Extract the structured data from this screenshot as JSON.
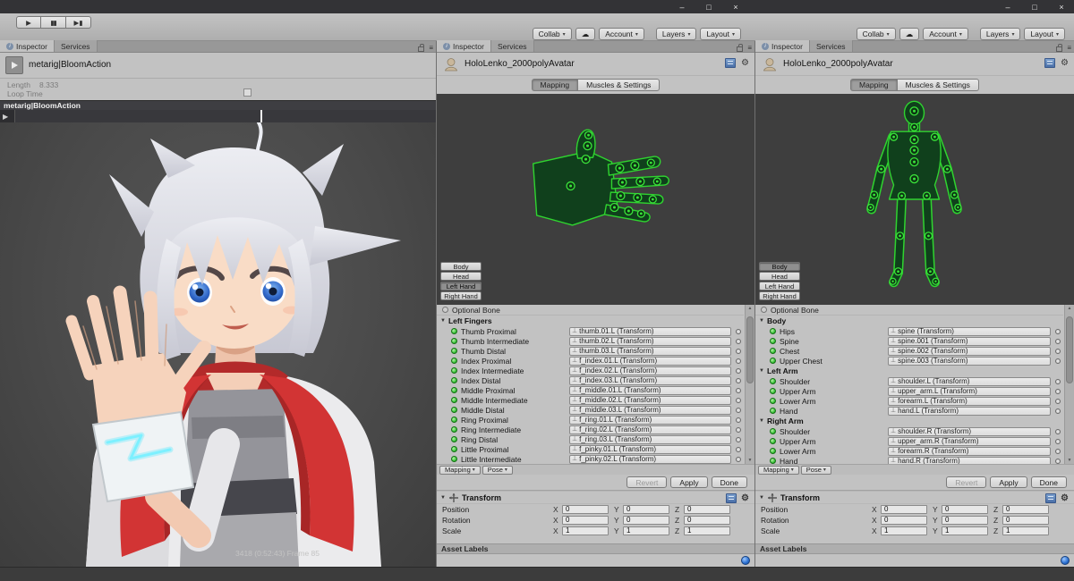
{
  "titlebar": {
    "minimize": "–",
    "restore": "□",
    "close": "×"
  },
  "icons": {
    "play": "▶",
    "pause": "▮▮",
    "step": "▶▮",
    "cloud": "☁",
    "dropdown": "▾",
    "menu": "≡",
    "info": "i",
    "transform_glyph": "⊥",
    "foldout": "▼",
    "gear": "⚙",
    "scroll_up": "▲",
    "scroll_down": "▼"
  },
  "toolbar": {
    "collab_label": "Collab",
    "account_label": "Account",
    "layers_label": "Layers",
    "layout_label": "Layout"
  },
  "tabs": {
    "inspector": "Inspector",
    "services": "Services"
  },
  "left_panel": {
    "clip_name": "metarig|BloomAction",
    "length_label": "Length",
    "length_value": "8.333",
    "loop_time_label": "Loop Time",
    "preview_title": "metarig|BloomAction",
    "frame_info": "3418 (0:52:43)  Frame 85"
  },
  "avatar": {
    "asset_name": "HoloLenko_2000polyAvatar",
    "mapping_tab": "Mapping",
    "muscles_tab": "Muscles & Settings",
    "view_buttons": [
      "Body",
      "Head",
      "Left Hand",
      "Right Hand"
    ],
    "optional_bone": "Optional Bone",
    "mapping_menu": "Mapping",
    "pose_menu": "Pose",
    "revert": "Revert",
    "apply": "Apply",
    "done": "Done",
    "transform_title": "Transform",
    "axis_labels": {
      "x": "X",
      "y": "Y",
      "z": "Z"
    },
    "transform_rows": [
      {
        "label": "Position",
        "x": "0",
        "y": "0",
        "z": "0"
      },
      {
        "label": "Rotation",
        "x": "0",
        "y": "0",
        "z": "0"
      },
      {
        "label": "Scale",
        "x": "1",
        "y": "1",
        "z": "1"
      }
    ],
    "asset_labels_title": "Asset Labels"
  },
  "hand_inspector": {
    "selected_view": "Left Hand",
    "groups": [
      {
        "name": "Left Fingers",
        "bones": [
          {
            "label": "Thumb Proximal",
            "target": "thumb.01.L (Transform)"
          },
          {
            "label": "Thumb Intermediate",
            "target": "thumb.02.L (Transform)"
          },
          {
            "label": "Thumb Distal",
            "target": "thumb.03.L (Transform)"
          },
          {
            "label": "Index Proximal",
            "target": "f_index.01.L (Transform)"
          },
          {
            "label": "Index Intermediate",
            "target": "f_index.02.L (Transform)"
          },
          {
            "label": "Index Distal",
            "target": "f_index.03.L (Transform)"
          },
          {
            "label": "Middle Proximal",
            "target": "f_middle.01.L (Transform)"
          },
          {
            "label": "Middle Intermediate",
            "target": "f_middle.02.L (Transform)"
          },
          {
            "label": "Middle Distal",
            "target": "f_middle.03.L (Transform)"
          },
          {
            "label": "Ring Proximal",
            "target": "f_ring.01.L (Transform)"
          },
          {
            "label": "Ring Intermediate",
            "target": "f_ring.02.L (Transform)"
          },
          {
            "label": "Ring Distal",
            "target": "f_ring.03.L (Transform)"
          },
          {
            "label": "Little Proximal",
            "target": "f_pinky.01.L (Transform)"
          },
          {
            "label": "Little Intermediate",
            "target": "f_pinky.02.L (Transform)"
          }
        ]
      }
    ]
  },
  "body_inspector": {
    "selected_view": "Body",
    "groups": [
      {
        "name": "Body",
        "bones": [
          {
            "label": "Hips",
            "target": "spine (Transform)"
          },
          {
            "label": "Spine",
            "target": "spine.001 (Transform)"
          },
          {
            "label": "Chest",
            "target": "spine.002 (Transform)"
          },
          {
            "label": "Upper Chest",
            "target": "spine.003 (Transform)"
          }
        ]
      },
      {
        "name": "Left Arm",
        "bones": [
          {
            "label": "Shoulder",
            "target": "shoulder.L (Transform)"
          },
          {
            "label": "Upper Arm",
            "target": "upper_arm.L (Transform)"
          },
          {
            "label": "Lower Arm",
            "target": "forearm.L (Transform)"
          },
          {
            "label": "Hand",
            "target": "hand.L (Transform)"
          }
        ]
      },
      {
        "name": "Right Arm",
        "bones": [
          {
            "label": "Shoulder",
            "target": "shoulder.R (Transform)"
          },
          {
            "label": "Upper Arm",
            "target": "upper_arm.R (Transform)"
          },
          {
            "label": "Lower Arm",
            "target": "forearm.R (Transform)"
          },
          {
            "label": "Hand",
            "target": "hand.R (Transform)"
          }
        ]
      }
    ]
  },
  "colors": {
    "bone_green": "#35c035",
    "diagram_green": "#2fd42f",
    "accent_blue": "#2a6fd0",
    "iris_blue": "#2f66c8"
  }
}
